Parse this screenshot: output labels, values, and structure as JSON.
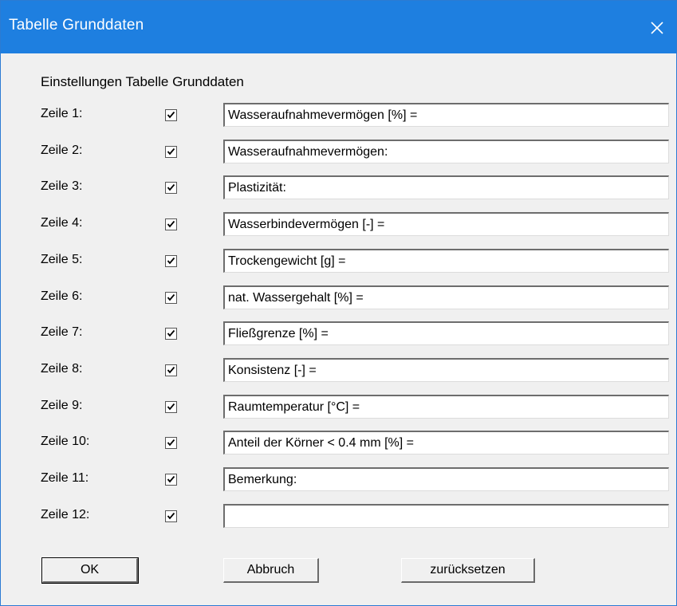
{
  "window": {
    "title": "Tabelle Grunddaten",
    "close_icon": "close-icon"
  },
  "dialog": {
    "heading": "Einstellungen Tabelle Grunddaten",
    "rows": [
      {
        "label": "Zeile 1:",
        "checked": true,
        "value": "Wasseraufnahmevermögen [%] ="
      },
      {
        "label": "Zeile 2:",
        "checked": true,
        "value": "Wasseraufnahmevermögen:"
      },
      {
        "label": "Zeile 3:",
        "checked": true,
        "value": "Plastizität:"
      },
      {
        "label": "Zeile 4:",
        "checked": true,
        "value": "Wasserbindevermögen [-] ="
      },
      {
        "label": "Zeile 5:",
        "checked": true,
        "value": "Trockengewicht [g] ="
      },
      {
        "label": "Zeile 6:",
        "checked": true,
        "value": "nat. Wassergehalt [%] ="
      },
      {
        "label": "Zeile 7:",
        "checked": true,
        "value": "Fließgrenze [%] ="
      },
      {
        "label": "Zeile 8:",
        "checked": true,
        "value": "Konsistenz [-] ="
      },
      {
        "label": "Zeile 9:",
        "checked": true,
        "value": "Raumtemperatur [°C] ="
      },
      {
        "label": "Zeile 10:",
        "checked": true,
        "value": "Anteil der Körner < 0.4 mm [%] ="
      },
      {
        "label": "Zeile 11:",
        "checked": true,
        "value": "Bemerkung:"
      },
      {
        "label": "Zeile 12:",
        "checked": true,
        "value": ""
      }
    ]
  },
  "buttons": {
    "ok": "OK",
    "cancel": "Abbruch",
    "reset": "zurücksetzen"
  },
  "colors": {
    "titlebar": "#1e7fe0",
    "title_text": "#ffffff",
    "background": "#f0f0f0"
  }
}
